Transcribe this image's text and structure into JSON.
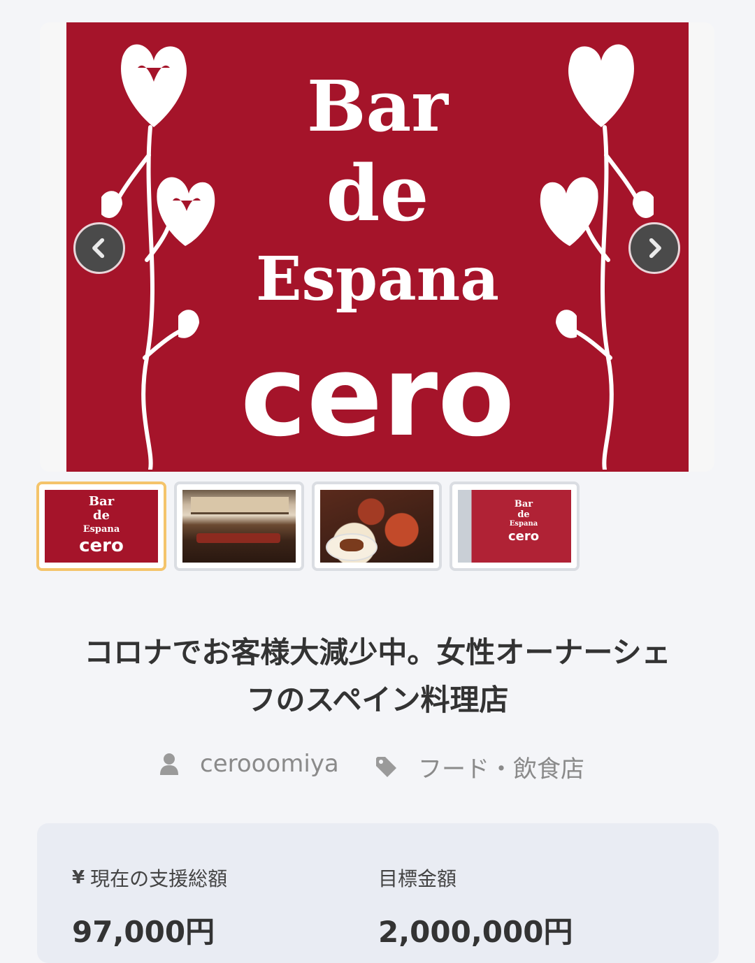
{
  "hero": {
    "sign": {
      "line1": "Bar",
      "line2": "de",
      "line3": "Espana",
      "line4": "cero"
    },
    "prev_icon": "chevron-left-icon",
    "next_icon": "chevron-right-icon"
  },
  "thumbnails": [
    {
      "name": "sign",
      "active": true,
      "lines": [
        "Bar",
        "de",
        "Espana",
        "cero"
      ]
    },
    {
      "name": "interior",
      "active": false
    },
    {
      "name": "food",
      "active": false
    },
    {
      "name": "storefront",
      "active": false,
      "lines": [
        "Bar",
        "de",
        "Espana",
        "cero"
      ]
    }
  ],
  "project": {
    "title_line1": "コロナでお客様大減少中。女性オーナーシェ",
    "title_line2": "フのスペイン料理店",
    "owner": "cerooomiya",
    "owner_icon": "user-icon",
    "category": "フード・飲食店",
    "category_icon": "tag-icon"
  },
  "stats": {
    "current_label": "現在の支援総額",
    "current_icon": "yen-icon",
    "current_value": "97,000円",
    "goal_label": "目標金額",
    "goal_value": "2,000,000円"
  },
  "colors": {
    "sign_red": "#a5142a",
    "active_thumb_border": "#f4c46b",
    "card_bg": "#e9ecf3"
  }
}
